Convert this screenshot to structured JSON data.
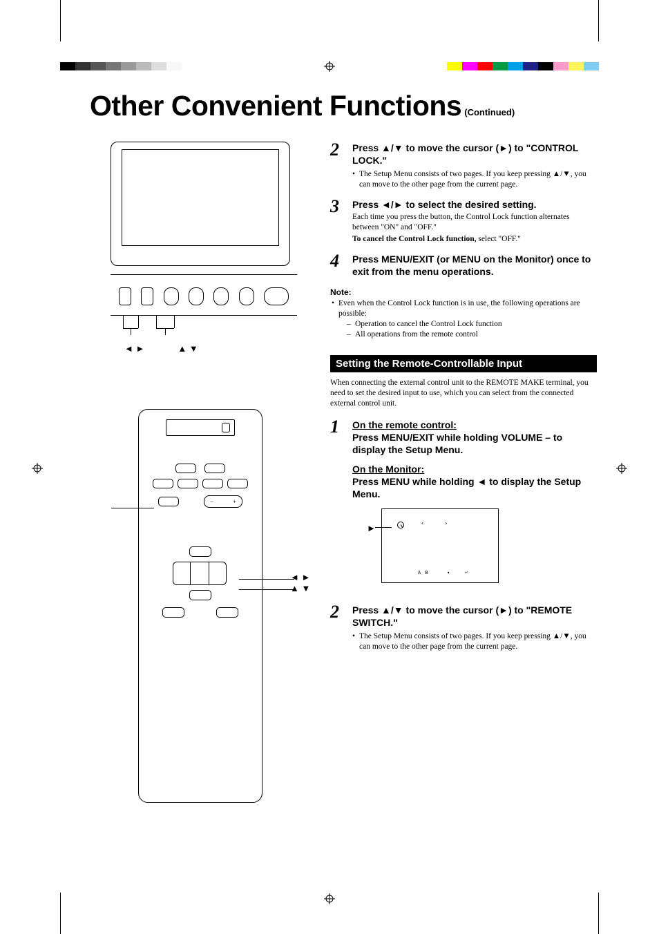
{
  "colorbar": {
    "left_grays": [
      "#000000",
      "#333333",
      "#555555",
      "#777777",
      "#999999",
      "#bbbbbb",
      "#dddddd",
      "#f9f9f9"
    ],
    "right_colors": [
      "#ffff00",
      "#ff00ff",
      "#ff0000",
      "#009944",
      "#00a0e9",
      "#1d2088",
      "#000000",
      "#ff9bcb",
      "#fff45c",
      "#7ecef4"
    ]
  },
  "title": {
    "main": "Other Convenient Functions",
    "suffix": "(Continued)"
  },
  "arrow_labels": {
    "leftright": "◄ ►",
    "updown": "▲ ▼"
  },
  "steps_top": [
    {
      "num": "2",
      "head": "Press ▲/▼ to move the cursor (►) to \"CONTROL LOCK.\"",
      "bullets": [
        "The Setup Menu consists of two pages. If you keep pressing ▲/▼, you can move to the other page from the current page."
      ]
    },
    {
      "num": "3",
      "head": "Press ◄/► to select the desired setting.",
      "desc": "Each time you press the button, the Control Lock function alternates between \"ON\" and \"OFF.\"",
      "bold_prefix": "To cancel the Control Lock function,",
      "bold_rest": " select \"OFF.\""
    },
    {
      "num": "4",
      "head": "Press MENU/EXIT (or MENU on the Monitor) once to exit from the menu operations."
    }
  ],
  "note": {
    "head": "Note:",
    "items": [
      {
        "text": "Even when the Control Lock function is in use, the following operations are possible:",
        "sub": [
          "Operation to cancel the Control Lock function",
          "All operations from the remote control"
        ]
      }
    ]
  },
  "section_bar": "Setting the Remote-Controllable Input",
  "intro": "When connecting the external control unit to the REMOTE MAKE terminal, you need to set the desired input to use, which you can select from the connected external control unit.",
  "steps_bottom": [
    {
      "num": "1",
      "head_lines": [
        {
          "underline": true,
          "text": "On the remote control:"
        },
        {
          "underline": false,
          "text": "Press MENU/EXIT while holding VOLUME – to display the Setup Menu."
        },
        {
          "spacer": true
        },
        {
          "underline": true,
          "text": "On the Monitor:"
        },
        {
          "underline": false,
          "text": "Press MENU while holding ◄ to display the Setup Menu."
        }
      ]
    },
    {
      "num": "2",
      "head": "Press ▲/▼ to move the cursor (►) to \"REMOTE SWITCH.\"",
      "bullets": [
        "The Setup Menu consists of two pages. If you keep pressing ▲/▼, you can move to the other page from the current page."
      ]
    }
  ]
}
